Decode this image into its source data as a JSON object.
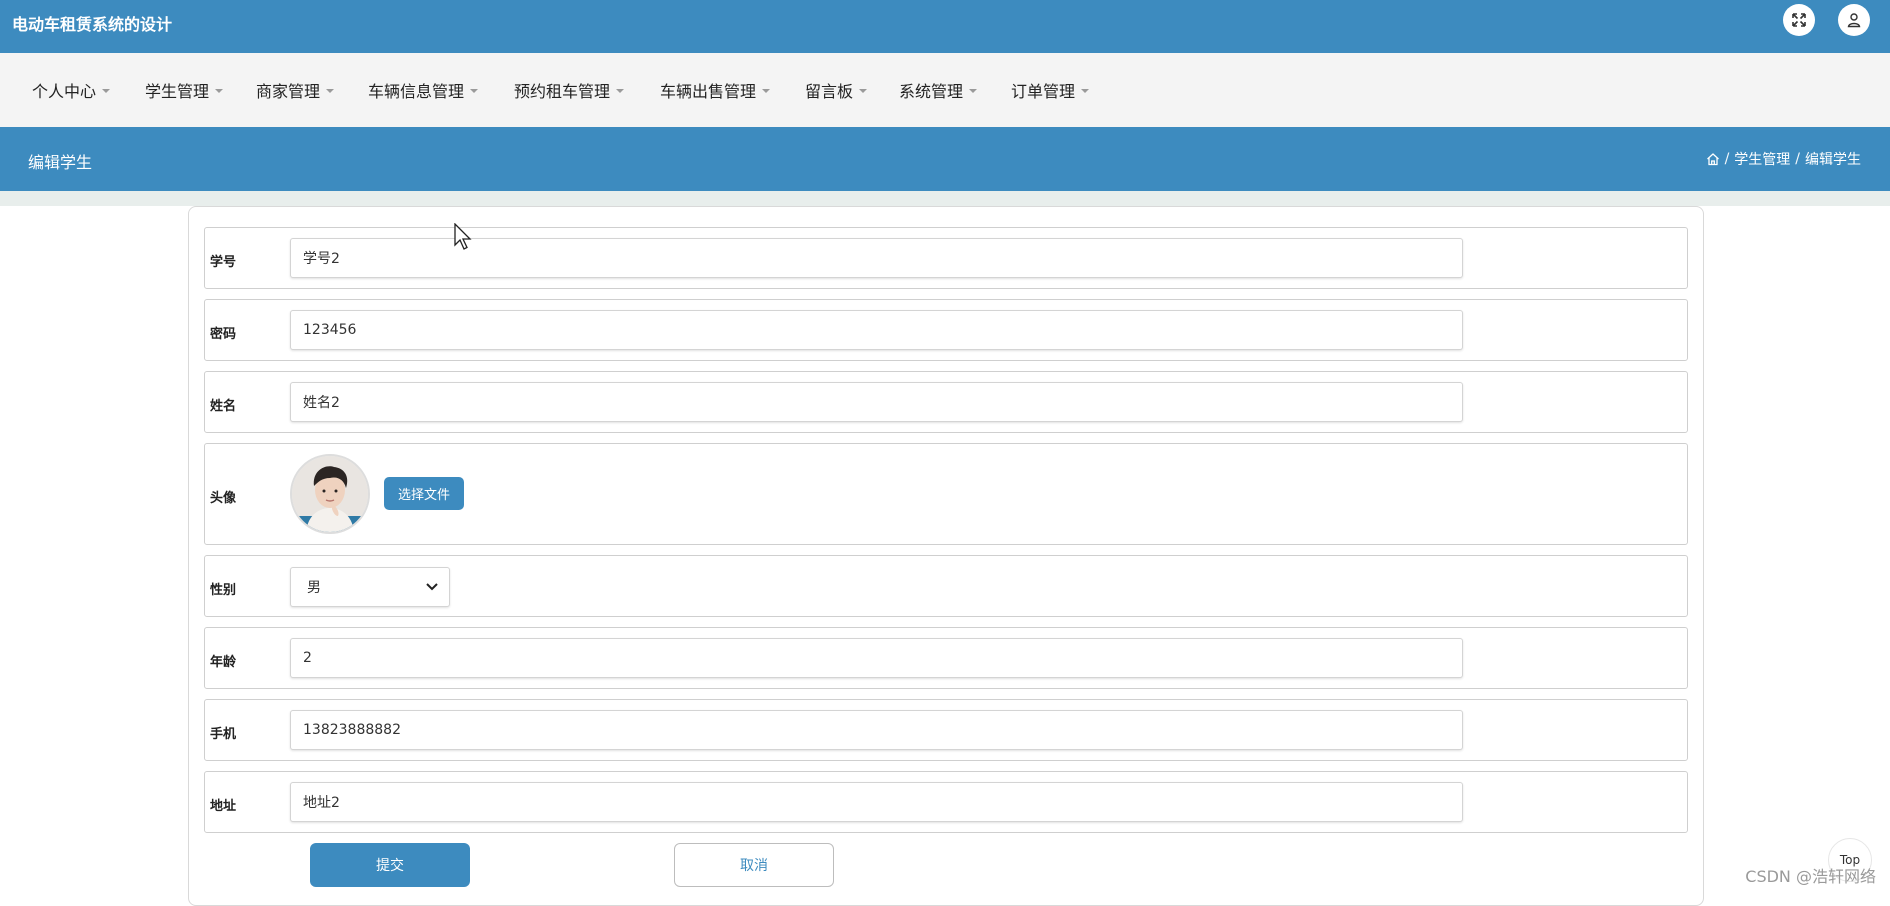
{
  "app": {
    "title": "电动车租赁系统的设计"
  },
  "header_icons": {
    "fullscreen": "fullscreen-icon",
    "user": "user-icon"
  },
  "nav": {
    "items": [
      {
        "label": "个人中心"
      },
      {
        "label": "学生管理"
      },
      {
        "label": "商家管理"
      },
      {
        "label": "车辆信息管理"
      },
      {
        "label": "预约租车管理"
      },
      {
        "label": "车辆出售管理"
      },
      {
        "label": "留言板"
      },
      {
        "label": "系统管理"
      },
      {
        "label": "订单管理"
      }
    ]
  },
  "page": {
    "title": "编辑学生",
    "breadcrumb": {
      "sep": "/",
      "section": "学生管理",
      "current": "编辑学生"
    }
  },
  "form": {
    "student_id": {
      "label": "学号",
      "value": "学号2"
    },
    "password": {
      "label": "密码",
      "value": "123456"
    },
    "name": {
      "label": "姓名",
      "value": "姓名2"
    },
    "avatar": {
      "label": "头像",
      "button": "选择文件"
    },
    "gender": {
      "label": "性别",
      "value": "男"
    },
    "age": {
      "label": "年龄",
      "value": "2"
    },
    "phone": {
      "label": "手机",
      "value": "13823888882"
    },
    "address": {
      "label": "地址",
      "value": "地址2"
    }
  },
  "actions": {
    "submit": "提交",
    "cancel": "取消"
  },
  "top_button": "Top",
  "watermark": "CSDN @浩轩网络",
  "colors": {
    "primary": "#3d8bbf",
    "nav_bg": "#f4f4f4"
  }
}
